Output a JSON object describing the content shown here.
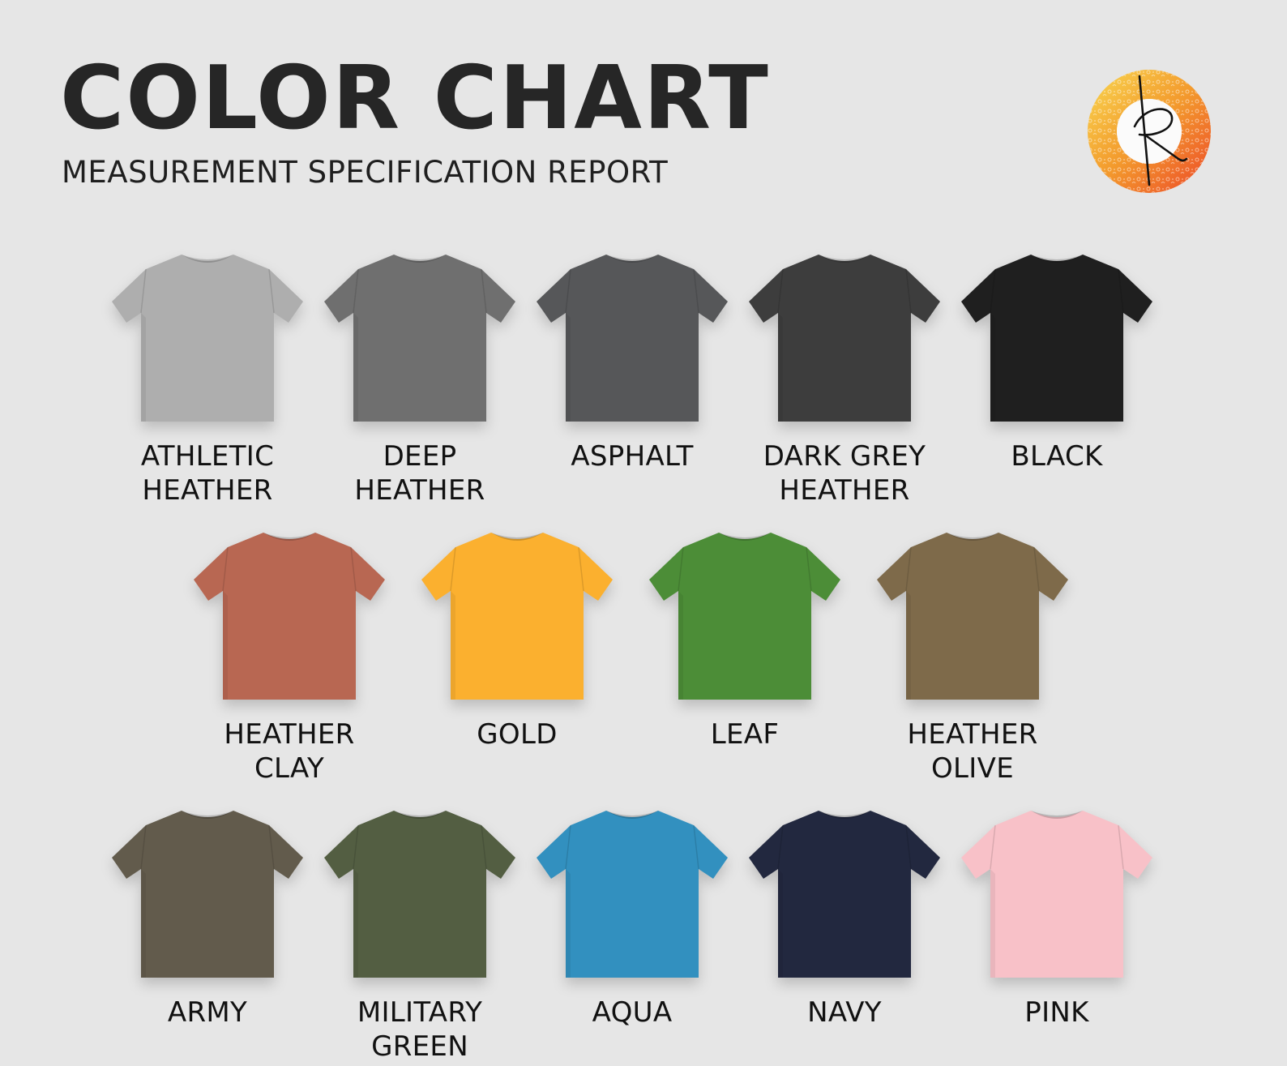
{
  "header": {
    "title": "COLOR CHART",
    "subtitle": "MEASUREMENT SPECIFICATION REPORT"
  },
  "logo": {
    "icon": "r-monogram-logo",
    "colors": [
      "#f7c948",
      "#f39a2d",
      "#ee5c2a"
    ]
  },
  "swatches": [
    {
      "label": "ATHLETIC\nHEATHER",
      "color": "#aeaeae"
    },
    {
      "label": "DEEP\nHEATHER",
      "color": "#6f6f6f"
    },
    {
      "label": "ASPHALT",
      "color": "#565759"
    },
    {
      "label": "DARK GREY\nHEATHER",
      "color": "#3d3d3d"
    },
    {
      "label": "BLACK",
      "color": "#1f1f1f"
    },
    {
      "label": "HEATHER\nCLAY",
      "color": "#b86752"
    },
    {
      "label": "GOLD",
      "color": "#fbb02f"
    },
    {
      "label": "LEAF",
      "color": "#4c8d37"
    },
    {
      "label": "HEATHER\nOLIVE",
      "color": "#7e6a4a"
    },
    {
      "label": "ARMY",
      "color": "#625b4c"
    },
    {
      "label": "MILITARY\nGREEN",
      "color": "#535e42"
    },
    {
      "label": "AQUA",
      "color": "#3290bf"
    },
    {
      "label": "NAVY",
      "color": "#22283f"
    },
    {
      "label": "PINK",
      "color": "#f8c1c8"
    }
  ]
}
